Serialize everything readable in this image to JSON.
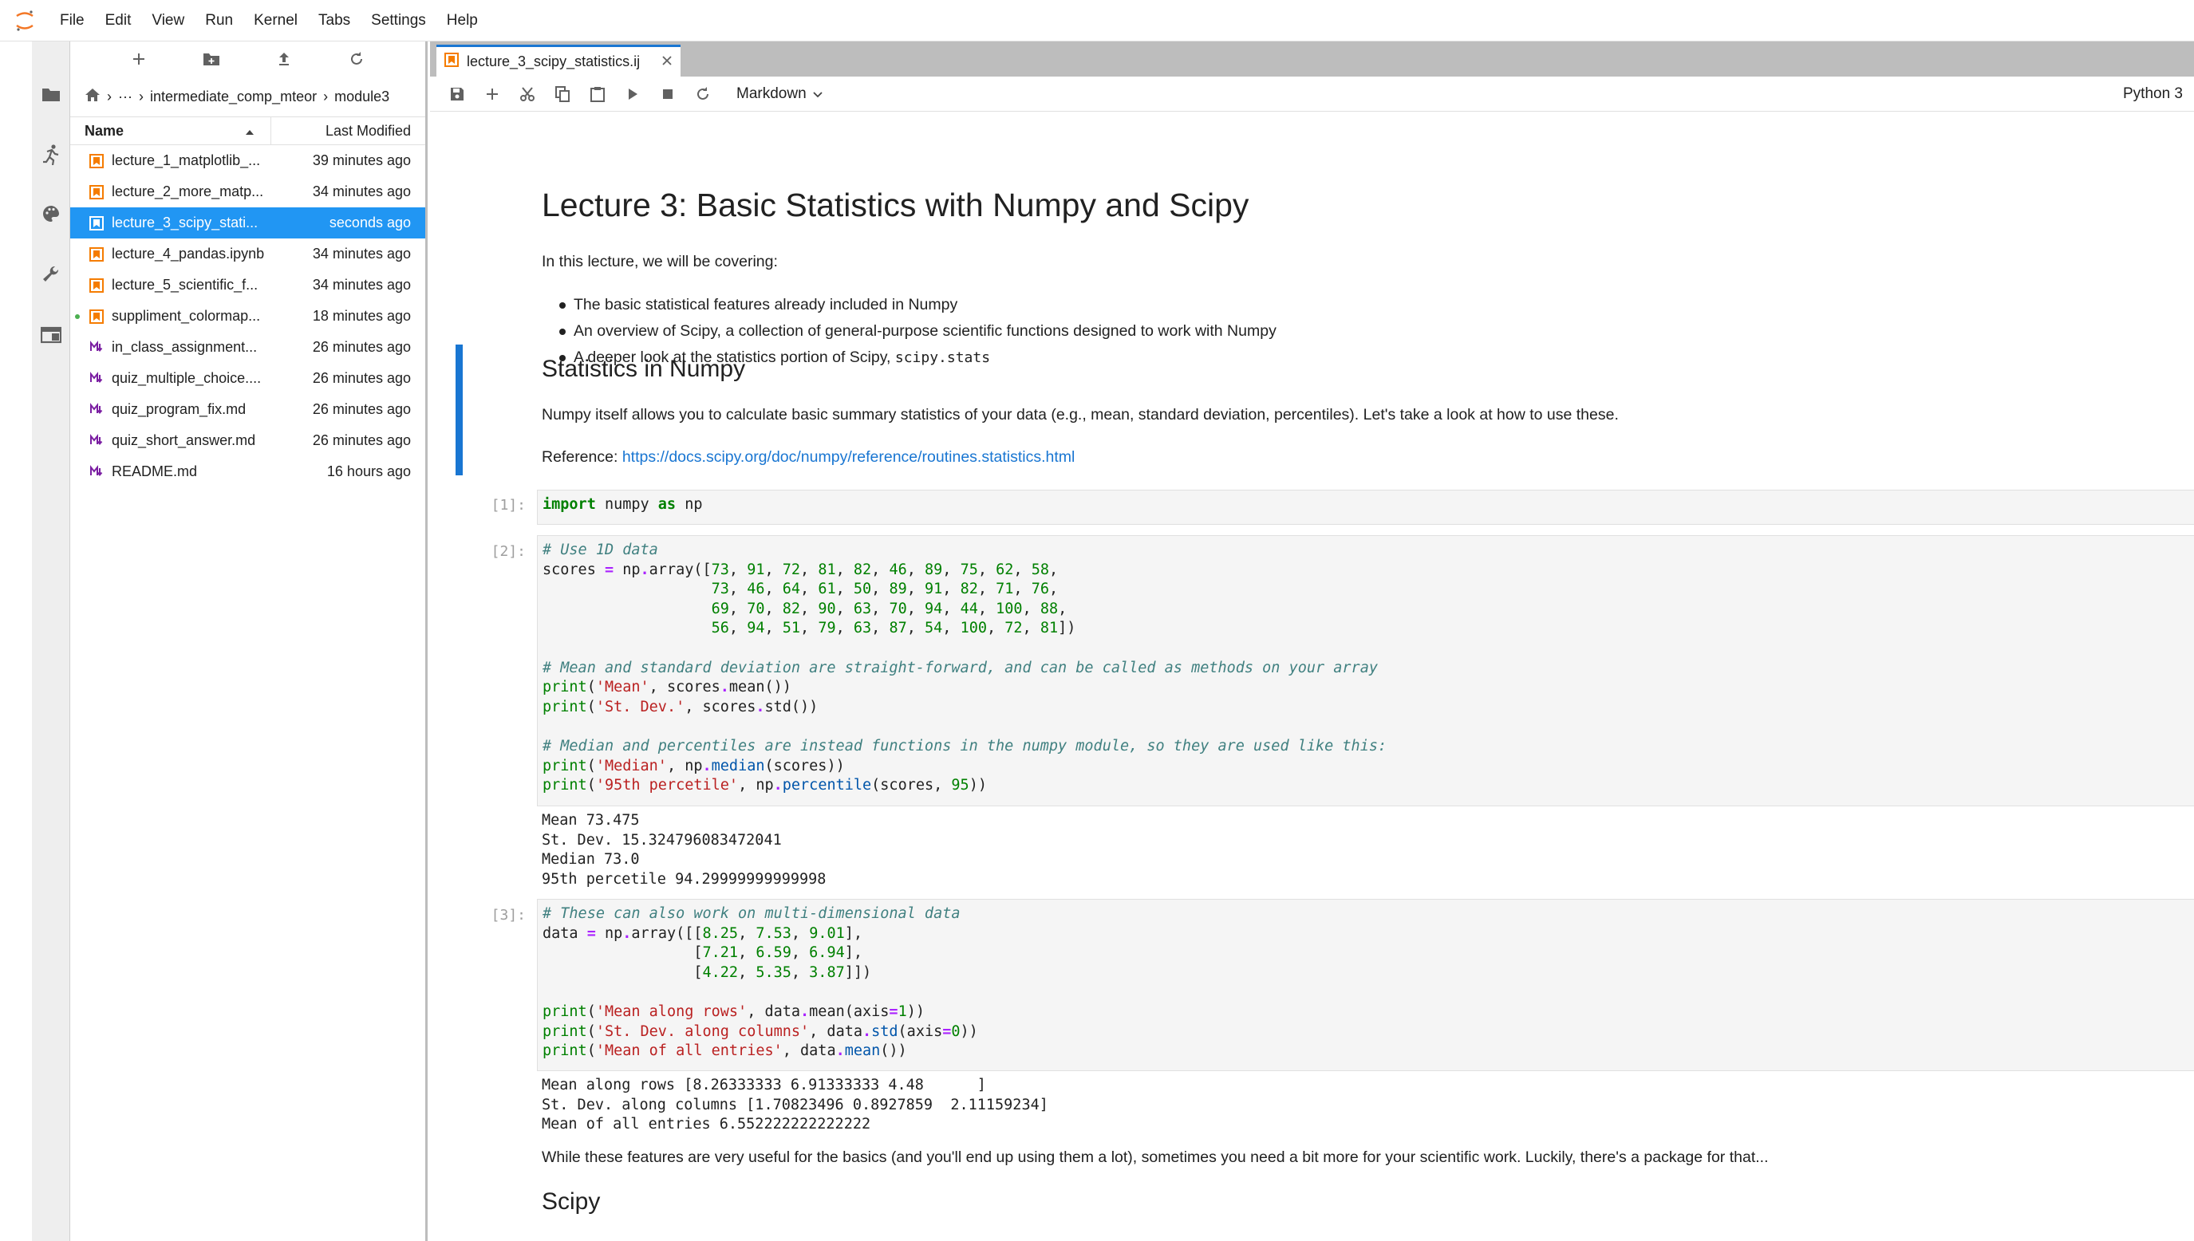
{
  "menubar": {
    "items": [
      "File",
      "Edit",
      "View",
      "Run",
      "Kernel",
      "Tabs",
      "Settings",
      "Help"
    ]
  },
  "activitybar": {
    "icons": [
      "folder-icon",
      "running-icon",
      "palette-icon",
      "wrench-icon",
      "tabs-icon"
    ]
  },
  "filebrowser": {
    "breadcrumb": {
      "ellipsis": "···",
      "parts": [
        "intermediate_comp_mteor",
        "module3"
      ]
    },
    "headers": {
      "name": "Name",
      "modified": "Last Modified"
    },
    "files": [
      {
        "name": "lecture_1_matplotlib_...",
        "modified": "39 minutes ago",
        "type": "notebook"
      },
      {
        "name": "lecture_2_more_matp...",
        "modified": "34 minutes ago",
        "type": "notebook"
      },
      {
        "name": "lecture_3_scipy_stati...",
        "modified": "seconds ago",
        "type": "notebook"
      },
      {
        "name": "lecture_4_pandas.ipynb",
        "modified": "34 minutes ago",
        "type": "notebook"
      },
      {
        "name": "lecture_5_scientific_f...",
        "modified": "34 minutes ago",
        "type": "notebook"
      },
      {
        "name": "suppliment_colormap...",
        "modified": "18 minutes ago",
        "type": "notebook"
      },
      {
        "name": "in_class_assignment...",
        "modified": "26 minutes ago",
        "type": "markdown"
      },
      {
        "name": "quiz_multiple_choice....",
        "modified": "26 minutes ago",
        "type": "markdown"
      },
      {
        "name": "quiz_program_fix.md",
        "modified": "26 minutes ago",
        "type": "markdown"
      },
      {
        "name": "quiz_short_answer.md",
        "modified": "26 minutes ago",
        "type": "markdown"
      },
      {
        "name": "README.md",
        "modified": "16 hours ago",
        "type": "markdown"
      }
    ],
    "selected_index": 2
  },
  "tab": {
    "label": "lecture_3_scipy_statistics.ij"
  },
  "toolbar": {
    "cell_type": "Markdown",
    "kernel": "Python 3"
  },
  "notebook": {
    "title": "Lecture 3: Basic Statistics with Numpy and Scipy",
    "intro": "In this lecture, we will be covering:",
    "bullets": [
      "The basic statistical features already included in Numpy",
      "An overview of Scipy, a collection of general-purpose scientific functions designed to work with Numpy",
      "A deeper look at the statistics portion of Scipy, "
    ],
    "bullet3_code": "scipy.stats",
    "h_numpy": "Statistics in Numpy",
    "numpy_para": "Numpy itself allows you to calculate basic summary statistics of your data (e.g., mean, standard deviation, percentiles). Let's take a look at how to use these.",
    "reference_label": "Reference: ",
    "reference_url": "https://docs.scipy.org/doc/numpy/reference/routines.statistics.html",
    "prompts": [
      "[1]:",
      "[2]:",
      "[3]:"
    ],
    "output2": "Mean 73.475\nSt. Dev. 15.324796083472041\nMedian 73.0\n95th percetile 94.29999999999998",
    "output3": "Mean along rows [8.26333333 6.91333333 4.48      ]\nSt. Dev. along columns [1.70823496 0.8927859  2.11159234]\nMean of all entries 6.552222222222222",
    "closing_para": "While these features are very useful for the basics (and you'll end up using them a lot), sometimes you need a bit more for your scientific work. Luckily, there's a package for that...",
    "h_scipy": "Scipy"
  },
  "colors": {
    "accent": "#1976d2",
    "selected": "#2196f3",
    "notebook_icon": "#f57c00",
    "markdown_icon": "#7b1fa2"
  }
}
